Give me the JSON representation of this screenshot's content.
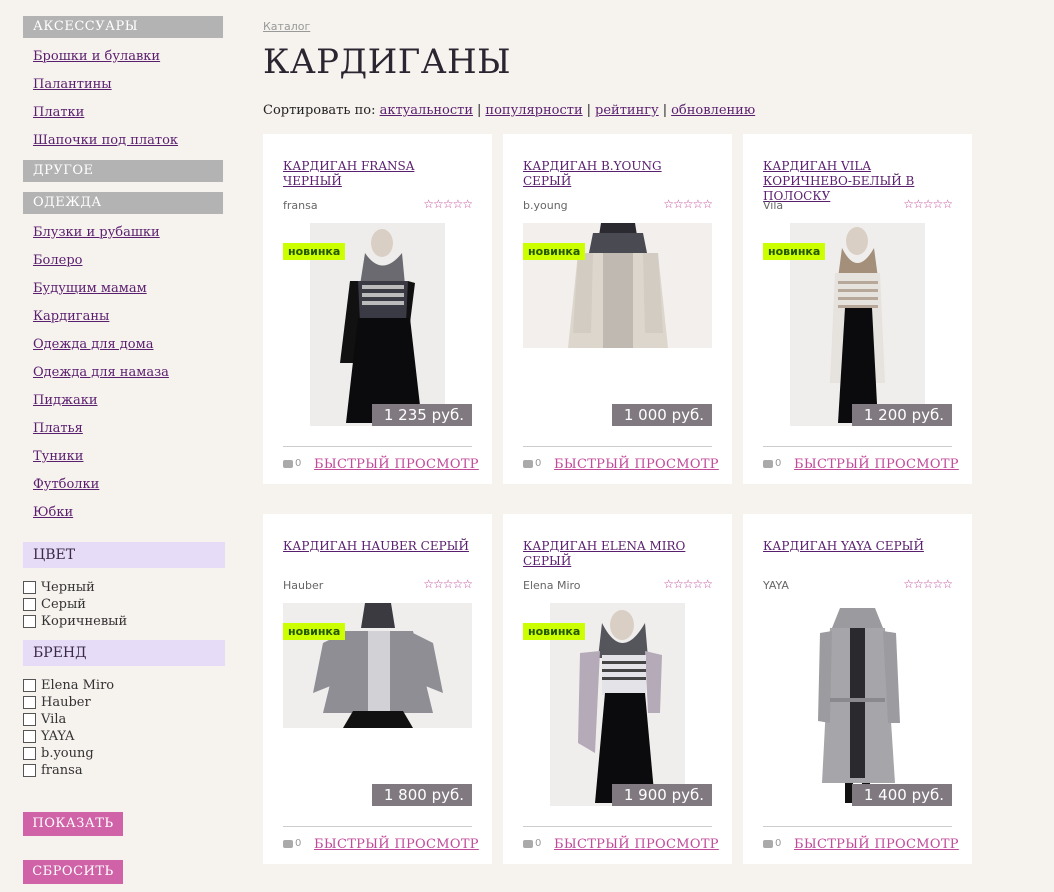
{
  "sidebar": {
    "categories": [
      {
        "header": "АКСЕССУАРЫ",
        "items": [
          "Брошки и булавки",
          "Палантины",
          "Платки",
          "Шапочки под платок"
        ]
      },
      {
        "header": "ДРУГОЕ",
        "items": []
      },
      {
        "header": "ОДЕЖДА",
        "items": [
          "Блузки и рубашки",
          "Болеро",
          "Будущим мамам",
          "Кардиганы",
          "Одежда для дома",
          "Одежда для намаза",
          "Пиджаки",
          "Платья",
          "Туники",
          "Футболки",
          "Юбки"
        ]
      }
    ],
    "filters": {
      "color": {
        "header": "ЦВЕТ",
        "options": [
          "Черный",
          "Серый",
          "Коричневый"
        ]
      },
      "brand": {
        "header": "БРЕНД",
        "options": [
          "Elena Miro",
          "Hauber",
          "Vila",
          "YAYA",
          "b.young",
          "fransa"
        ]
      }
    },
    "show_button": "ПОКАЗАТЬ",
    "reset_button": "СБРОСИТЬ"
  },
  "breadcrumb": "Каталог",
  "title": "КАРДИГАНЫ",
  "sort": {
    "label": "Сортировать по:",
    "options": [
      "актуальности",
      "популярности",
      "рейтингу",
      "обновлению"
    ],
    "separator": "|"
  },
  "products": [
    {
      "title": "КАРДИГАН FRANSA ЧЕРНЫЙ",
      "brand": "fransa",
      "rating": "☆☆☆☆☆",
      "badge": "новинка",
      "price": "1 235 руб.",
      "comments": "0",
      "quick_view": "БЫСТРЫЙ ПРОСМОТР"
    },
    {
      "title": "КАРДИГАН B.YOUNG СЕРЫЙ",
      "brand": "b.young",
      "rating": "☆☆☆☆☆",
      "badge": "новинка",
      "price": "1 000 руб.",
      "comments": "0",
      "quick_view": "БЫСТРЫЙ ПРОСМОТР"
    },
    {
      "title": "КАРДИГАН VILA КОРИЧНЕВО-БЕЛЫЙ В ПОЛОСКУ",
      "brand": "Vila",
      "rating": "☆☆☆☆☆",
      "badge": "новинка",
      "price": "1 200 руб.",
      "comments": "0",
      "quick_view": "БЫСТРЫЙ ПРОСМОТР"
    },
    {
      "title": "КАРДИГАН HAUBER СЕРЫЙ",
      "brand": "Hauber",
      "rating": "☆☆☆☆☆",
      "badge": "новинка",
      "price": "1 800 руб.",
      "comments": "0",
      "quick_view": "БЫСТРЫЙ ПРОСМОТР"
    },
    {
      "title": "КАРДИГАН ELENA MIRO СЕРЫЙ",
      "brand": "Elena Miro",
      "rating": "☆☆☆☆☆",
      "badge": "новинка",
      "price": "1 900 руб.",
      "comments": "0",
      "quick_view": "БЫСТРЫЙ ПРОСМОТР"
    },
    {
      "title": "КАРДИГАН YAYA СЕРЫЙ",
      "brand": "YAYA",
      "rating": "☆☆☆☆☆",
      "badge": "",
      "price": "1 400 руб.",
      "comments": "0",
      "quick_view": "БЫСТРЫЙ ПРОСМОТР"
    }
  ],
  "colors": {
    "accent": "#d063a8",
    "link": "#5a1e6e",
    "badge": "#ccff00",
    "price_bg": "#807a80"
  }
}
